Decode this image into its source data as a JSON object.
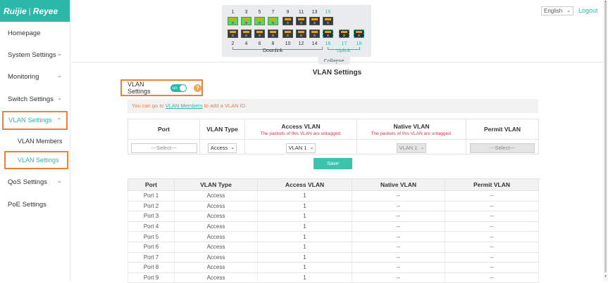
{
  "brand": {
    "logo_left": "Ruijie",
    "logo_sep": "|",
    "logo_right": "Reyee",
    "accent": "#2bb8a8",
    "highlight": "#f07f3c"
  },
  "sidebar": {
    "items": [
      {
        "label": "Homepage"
      },
      {
        "label": "System Settings",
        "chevron": "chevron-down-icon"
      },
      {
        "label": "Monitoring",
        "chevron": "chevron-down-icon"
      },
      {
        "label": "Switch Settings",
        "chevron": "chevron-down-icon"
      },
      {
        "label": "VLAN Settings",
        "chevron": "chevron-up-icon",
        "active": true
      },
      {
        "label": "VLAN Members",
        "sub": true
      },
      {
        "label": "VLAN Settings",
        "sub": true,
        "active": true
      },
      {
        "label": "QoS Settings",
        "chevron": "chevron-down-icon"
      },
      {
        "label": "PoE Settings"
      }
    ]
  },
  "panel": {
    "top_numbers": [
      "1",
      "3",
      "5",
      "7",
      "9",
      "11",
      "13",
      "15"
    ],
    "bottom_numbers": [
      "2",
      "4",
      "6",
      "8",
      "10",
      "12",
      "14",
      "16",
      "17",
      "18"
    ],
    "downlink_label": "Downlink",
    "uplink_label": "Uplink",
    "collapse_label": "Collapse"
  },
  "header": {
    "language": "English",
    "logout": "Logout"
  },
  "page": {
    "title": "VLAN Settings"
  },
  "toggle": {
    "label": "VLAN Settings",
    "state": "on",
    "help": "?"
  },
  "notice": {
    "before": "You can go to ",
    "link": "VLAN Members",
    "after": " to add a VLAN ID."
  },
  "config": {
    "headers": {
      "port": "Port",
      "vlan_type": "VLAN Type",
      "access_vlan": "Access VLAN",
      "access_sub": "The packets of this VLAN are untagged.",
      "native_vlan": "Native VLAN",
      "native_sub": "The packets of this VLAN are untagged.",
      "permit_vlan": "Permit VLAN"
    },
    "port_select": "---Select---",
    "type_select": "Access",
    "access_select": "VLAN 1",
    "native_select": "VLAN 1",
    "permit_select": "---Select---",
    "save_label": "Save"
  },
  "list": {
    "headers": [
      "Port",
      "VLAN Type",
      "Access VLAN",
      "Native VLAN",
      "Permit VLAN"
    ],
    "rows": [
      [
        "Port 1",
        "Access",
        "1",
        "--",
        "--"
      ],
      [
        "Port 2",
        "Access",
        "1",
        "--",
        "--"
      ],
      [
        "Port 3",
        "Access",
        "1",
        "--",
        "--"
      ],
      [
        "Port 4",
        "Access",
        "1",
        "--",
        "--"
      ],
      [
        "Port 5",
        "Access",
        "1",
        "--",
        "--"
      ],
      [
        "Port 6",
        "Access",
        "1",
        "--",
        "--"
      ],
      [
        "Port 7",
        "Access",
        "1",
        "--",
        "--"
      ],
      [
        "Port 8",
        "Access",
        "1",
        "--",
        "--"
      ],
      [
        "Port 9",
        "Access",
        "1",
        "--",
        "--"
      ]
    ]
  }
}
